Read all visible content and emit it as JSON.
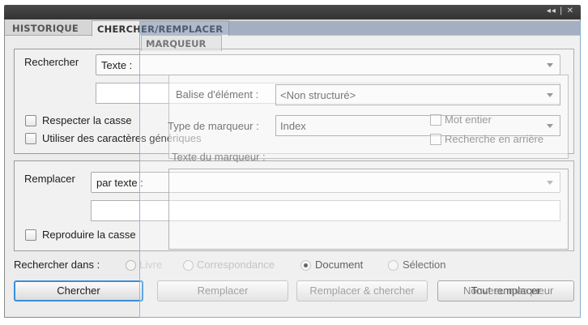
{
  "window": {
    "controls": "◂◂ | ✕"
  },
  "tabs": [
    {
      "label": "HISTORIQUE",
      "active": false
    },
    {
      "label": "CHERCHER/REMPLACER",
      "active": true
    }
  ],
  "search": {
    "label": "Rechercher",
    "mode_value": "Texte :",
    "input_value": "",
    "match_case_label": "Respecter la casse",
    "wildcards_label": "Utiliser des caractères génériques"
  },
  "replace": {
    "label": "Remplacer",
    "mode_value": "par texte :",
    "input_value": "",
    "keep_case_label": "Reproduire la casse"
  },
  "scope": {
    "label": "Rechercher dans :",
    "options": [
      {
        "label": "Livre",
        "selected": false
      },
      {
        "label": "Correspondance",
        "selected": false
      },
      {
        "label": "Document",
        "selected": true
      },
      {
        "label": "Sélection",
        "selected": false
      }
    ]
  },
  "buttons": {
    "find": "Chercher",
    "replace": "Remplacer",
    "replace_find": "Remplacer & chercher",
    "replace_all": "Tout remplacer",
    "marker_overlay_button": "Nouveau marqueur"
  },
  "marker_panel": {
    "tab_label": "MARQUEUR",
    "element_tag_label": "Balise d'élément :",
    "element_tag_value": "<Non structuré>",
    "marker_type_label": "Type de marqueur :",
    "marker_type_value": "Index",
    "whole_word_label": "Mot entier",
    "backward_label": "Recherche en arrière",
    "marker_text_label": "Texte du marqueur :"
  },
  "colors": {
    "focus_accent": "#3b8ed8",
    "title_bar": "#3d3d3d"
  }
}
